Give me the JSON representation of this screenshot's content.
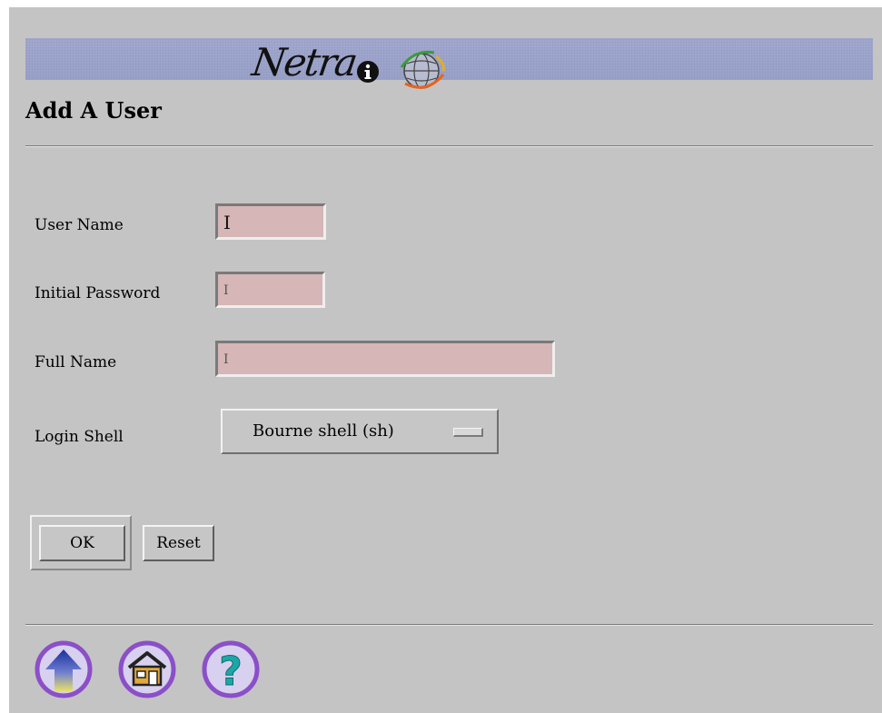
{
  "brand": {
    "name": "Netra",
    "info_icon": "info-icon",
    "logo_icon": "globe-icon"
  },
  "page": {
    "title": "Add A User"
  },
  "form": {
    "user_name": {
      "label": "User Name",
      "value": ""
    },
    "initial_password": {
      "label": "Initial Password",
      "value": ""
    },
    "full_name": {
      "label": "Full Name",
      "value": ""
    },
    "login_shell": {
      "label": "Login Shell",
      "selected": "Bourne shell (sh)"
    }
  },
  "buttons": {
    "ok": "OK",
    "reset": "Reset"
  },
  "nav": {
    "icons": [
      "up-arrow-icon",
      "home-icon",
      "help-icon"
    ]
  },
  "colors": {
    "background": "#c4c4c4",
    "banner": "#9fa5cc",
    "input_fill": "#d6b6b6",
    "icon_purple": "#8b4fc8"
  }
}
